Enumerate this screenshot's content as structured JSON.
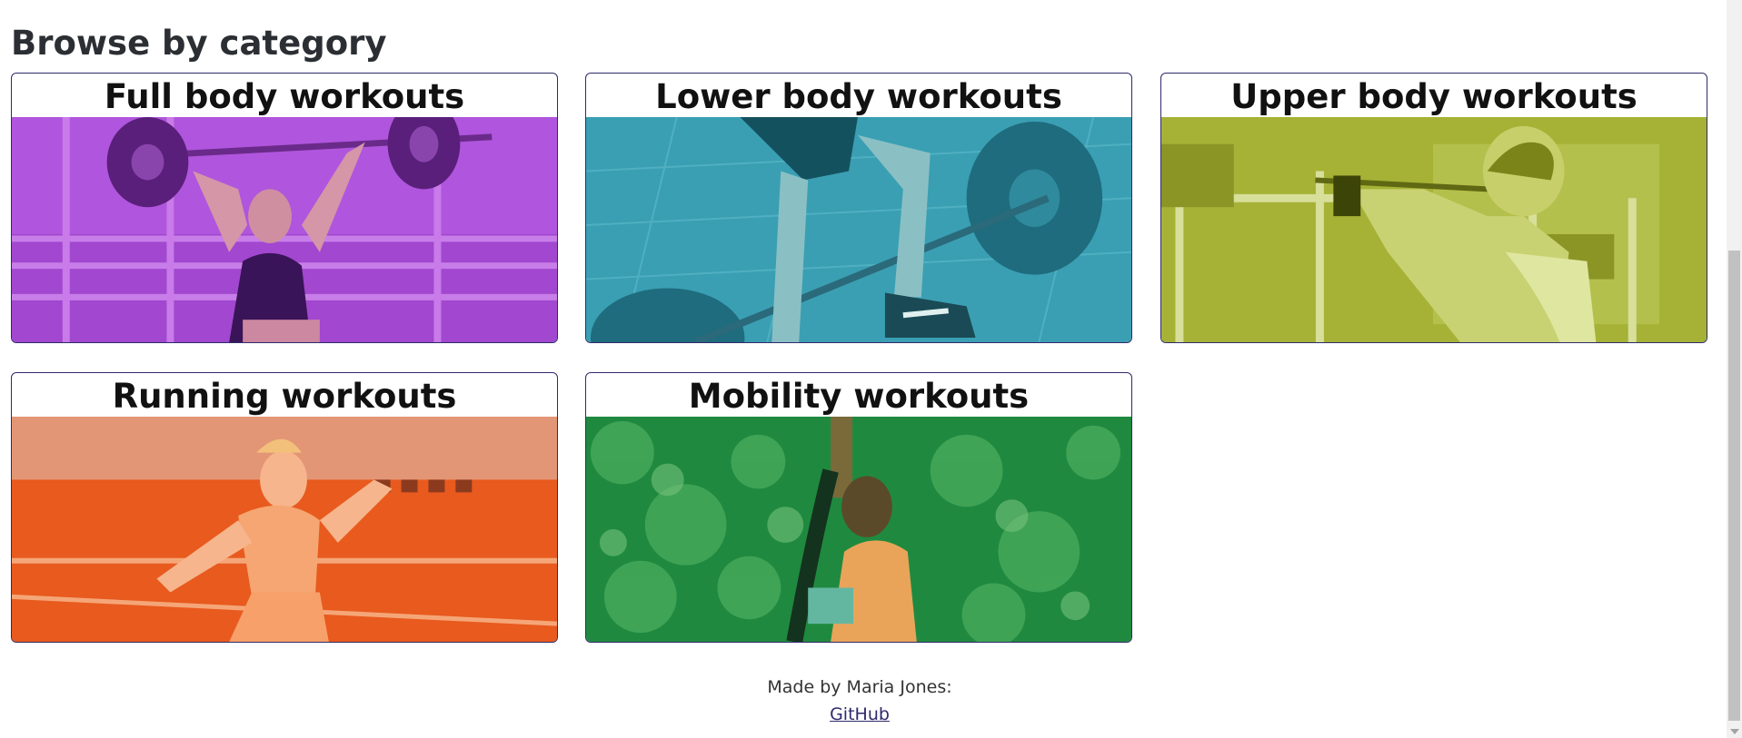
{
  "section": {
    "title": "Browse by category"
  },
  "categories": [
    {
      "title": "Full body workouts",
      "color": "#b24fe0",
      "icon": "barbell-overhead-squat-photo"
    },
    {
      "title": "Lower body workouts",
      "color": "#2ea3b8",
      "icon": "barbell-deadlift-photo"
    },
    {
      "title": "Upper body workouts",
      "color": "#a8b52c",
      "icon": "cable-machine-photo"
    },
    {
      "title": "Running workouts",
      "color": "#f26322",
      "icon": "sprinter-photo"
    },
    {
      "title": "Mobility workouts",
      "color": "#1e8a3e",
      "icon": "stretching-photo"
    }
  ],
  "footer": {
    "made_by": "Made by Maria Jones:",
    "link_label": "GitHub"
  }
}
